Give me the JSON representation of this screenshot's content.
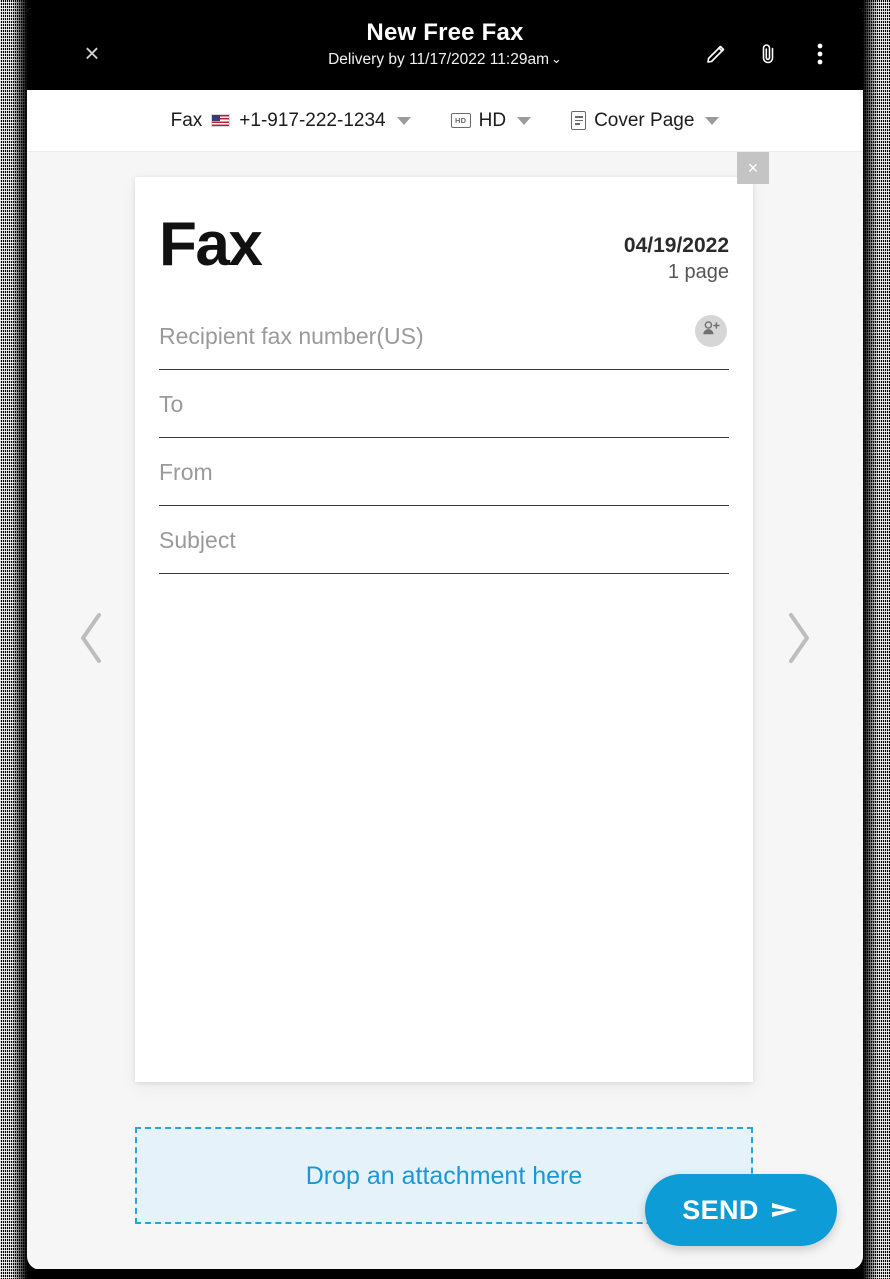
{
  "header": {
    "title": "New Free Fax",
    "delivery_text": "Delivery by 11/17/2022 11:29am",
    "delivery_caret": "⌄",
    "close_label": "×",
    "actions": [
      {
        "name": "edit-icon",
        "label": "Edit"
      },
      {
        "name": "attachment-icon",
        "label": "Attach"
      },
      {
        "name": "more-options-icon",
        "label": "More options"
      }
    ]
  },
  "toolbar": {
    "fax_number_prefix": "Fax",
    "fax_number": "+1-917-222-1234",
    "quality_label": "HD",
    "quality_icon_text": "HD",
    "cover_page_label": "Cover Page"
  },
  "navigation": {
    "prev_label": "Previous page",
    "next_label": "Next page"
  },
  "document": {
    "close_label": "×",
    "heading": "Fax",
    "date": "04/19/2022",
    "page_count": "1 page",
    "fields": [
      {
        "name": "recipient-fax-number",
        "placeholder": "Recipient fax number(US)",
        "value": ""
      },
      {
        "name": "to",
        "placeholder": "To",
        "value": ""
      },
      {
        "name": "from",
        "placeholder": "From",
        "value": ""
      },
      {
        "name": "subject",
        "placeholder": "Subject",
        "value": ""
      }
    ],
    "add_contact_label": "Add contact"
  },
  "dropzone": {
    "label": "Drop an attachment here"
  },
  "send": {
    "label": "SEND"
  },
  "colors": {
    "accent_blue": "#0e9cd6",
    "dropzone_border": "#29a3dc",
    "dropzone_fill": "#e5f2fa",
    "dropzone_text": "#1b97d5",
    "header_black": "#000000",
    "workspace_gray": "#f6f6f6"
  }
}
